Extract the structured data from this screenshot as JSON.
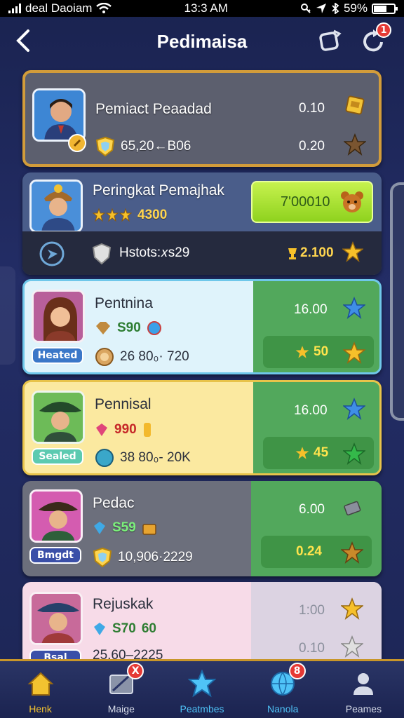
{
  "status_bar": {
    "carrier": "deal Daoiam",
    "time": "13:3 AM",
    "battery": "59%",
    "signal_icon": "signal-icon",
    "wifi_icon": "wifi-icon"
  },
  "header": {
    "title": "Pedimaisa",
    "back_icon": "back-arrow-icon",
    "action_a_icon": "card-swap-icon",
    "action_b_icon": "refresh-icon",
    "notification_count": "1"
  },
  "rows": [
    {
      "name": "Pemiact Peaadad",
      "stat": "65,20←B06",
      "value_top": "0.10",
      "value_bottom": "0.20",
      "accent": "#e9b437"
    },
    {
      "name": "Peringkat Pemajhak",
      "rating": "4300",
      "badge_value": "7'00010",
      "sub_label": "Hstots:𝑥s29",
      "sub_value": "2.100"
    },
    {
      "name": "Pentnina",
      "tag": "Heated",
      "gems": "S90",
      "stat": "26 80₀· 720",
      "value_top": "16.00",
      "value_pill": "50"
    },
    {
      "name": "Pennisal",
      "tag": "Sealed",
      "gems": "990",
      "stat": "38 80₀- 20K",
      "value_top": "16.00",
      "value_pill": "45"
    },
    {
      "name": "Pedac",
      "tag": "Bmgdt",
      "gems": "S59",
      "stat": "10,906·2229",
      "value_top": "6.00",
      "value_pill": "0.24"
    },
    {
      "name": "Rejuskak",
      "tag": "Bsal",
      "gems": "S70",
      "gems2": "60",
      "stat": "25.60–2225",
      "value_top": "1:00",
      "value_bottom": "0.10"
    }
  ],
  "nav": [
    {
      "label": "Henk",
      "icon": "home-icon",
      "color": "#f2c230"
    },
    {
      "label": "Maige",
      "icon": "image-edit-icon",
      "badge": "X",
      "color": "#d6dbe8"
    },
    {
      "label": "Peatmbes",
      "icon": "star-badge-icon",
      "color": "#4fc3f7"
    },
    {
      "label": "Nanola",
      "icon": "globe-icon",
      "badge": "8",
      "color": "#4fc3f7"
    },
    {
      "label": "Peames",
      "icon": "profile-icon",
      "color": "#d6dbe8"
    }
  ]
}
